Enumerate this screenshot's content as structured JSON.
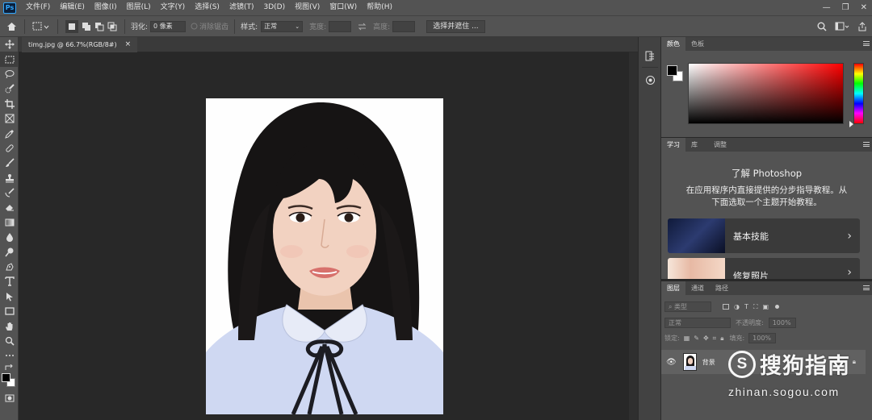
{
  "app": {
    "logo_text": "Ps"
  },
  "menu": [
    "文件(F)",
    "编辑(E)",
    "图像(I)",
    "图层(L)",
    "文字(Y)",
    "选择(S)",
    "滤镜(T)",
    "3D(D)",
    "视图(V)",
    "窗口(W)",
    "帮助(H)"
  ],
  "options": {
    "feather_label": "羽化:",
    "feather_value": "0 像素",
    "antialias_label": "消除锯齿",
    "style_label": "样式:",
    "style_value": "正常",
    "width_label": "宽度:",
    "height_label": "高度:",
    "select_mask_button": "选择并遮住 ..."
  },
  "document": {
    "tab_title": "timg.jpg @ 66.7%(RGB/8#)",
    "close_symbol": "×"
  },
  "color_panel": {
    "tabs": [
      "颜色",
      "色板"
    ],
    "foreground": "#000000",
    "background": "#ffffff"
  },
  "learn_panel": {
    "tabs": [
      "学习",
      "库",
      "调整"
    ],
    "title": "了解 Photoshop",
    "description": "在应用程序内直接提供的分步指导教程。从下面选取一个主题开始教程。",
    "cards": [
      {
        "label": "基本技能",
        "chevron": "›"
      },
      {
        "label": "修复照片",
        "chevron": "›"
      }
    ]
  },
  "layers_panel": {
    "tabs": [
      "图层",
      "通道",
      "路径"
    ],
    "filter_placeholder": "类型",
    "blend_mode": "正常",
    "opacity_label": "不透明度:",
    "opacity_value": "100%",
    "lock_label": "锁定:",
    "fill_label": "填充:",
    "fill_value": "100%",
    "layer_name": "背景"
  },
  "watermark": {
    "brand": "搜狗指南",
    "url": "zhinan.sogou.com"
  }
}
